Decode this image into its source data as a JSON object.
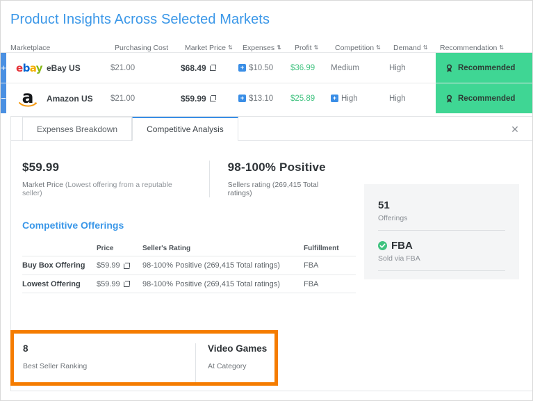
{
  "page_title": "Product Insights Across Selected Markets",
  "colors": {
    "title_blue": "#3a97e8",
    "accent_blue": "#4a90e2",
    "recommend_green": "#3fd694",
    "profit_green": "#3fc27f",
    "highlight_orange": "#f57c00"
  },
  "table": {
    "headers": [
      {
        "label": "Marketplace",
        "sortable": false
      },
      {
        "label": "Purchasing Cost",
        "sortable": false
      },
      {
        "label": "Market Price",
        "sortable": true
      },
      {
        "label": "Expenses",
        "sortable": true
      },
      {
        "label": "Profit",
        "sortable": true
      },
      {
        "label": "Competition",
        "sortable": true
      },
      {
        "label": "Demand",
        "sortable": true
      },
      {
        "label": "Recommendation",
        "sortable": true
      }
    ],
    "sort_glyph": "⇅",
    "rows": [
      {
        "expand_toggle": "+",
        "logo": "ebay-logo",
        "marketplace": "eBay US",
        "purchasing_cost": "$21.00",
        "market_price": "$68.49",
        "expenses": "$10.50",
        "expenses_has_badge": true,
        "profit": "$36.99",
        "competition": "Medium",
        "competition_has_badge": false,
        "demand": "High",
        "recommendation": "Recommended"
      },
      {
        "expand_toggle": "−",
        "logo": "amazon-logo",
        "marketplace": "Amazon US",
        "purchasing_cost": "$21.00",
        "market_price": "$59.99",
        "expenses": "$13.10",
        "expenses_has_badge": true,
        "profit": "$25.89",
        "competition": "High",
        "competition_has_badge": true,
        "demand": "High",
        "recommendation": "Recommended"
      }
    ]
  },
  "detail": {
    "tabs": [
      {
        "label": "Expenses Breakdown",
        "active": false
      },
      {
        "label": "Competitive Analysis",
        "active": true
      }
    ],
    "close_glyph": "✕",
    "summary": [
      {
        "value": "$59.99",
        "label": "Market Price",
        "note": "(Lowest offering from a reputable seller)"
      },
      {
        "value": "98-100% Positive",
        "label": "Sellers rating (269,415 Total ratings)",
        "note": ""
      }
    ],
    "offerings": {
      "title": "Competitive Offerings",
      "headers": [
        "",
        "Price",
        "Seller's Rating",
        "Fulfillment"
      ],
      "rows": [
        {
          "label": "Buy Box Offering",
          "price": "$59.99",
          "rating": "98-100% Positive (269,415 Total ratings)",
          "fulfillment": "FBA"
        },
        {
          "label": "Lowest Offering",
          "price": "$59.99",
          "rating": "98-100% Positive (269,415 Total ratings)",
          "fulfillment": "FBA"
        }
      ]
    },
    "side_card": [
      {
        "value": "51",
        "label": "Offerings",
        "has_check": false
      },
      {
        "value": "FBA",
        "label": "Sold via FBA",
        "has_check": true
      }
    ],
    "highlight": [
      {
        "value": "8",
        "label": "Best Seller Ranking"
      },
      {
        "value": "Video Games",
        "label": "At Category"
      }
    ]
  }
}
